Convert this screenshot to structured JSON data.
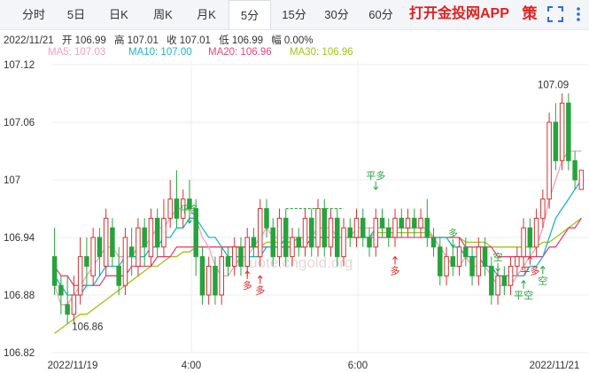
{
  "tabs": [
    {
      "label": "分时"
    },
    {
      "label": "5日"
    },
    {
      "label": "日K"
    },
    {
      "label": "周K"
    },
    {
      "label": "月K"
    },
    {
      "label": "5分"
    },
    {
      "label": "15分"
    },
    {
      "label": "30分"
    },
    {
      "label": "60分"
    }
  ],
  "active_tab": "5分",
  "promo": "打开金投网APP",
  "ce_badge": "策",
  "info": {
    "date": "2022/11/21",
    "open": "开 106.99",
    "high": "高 107.01",
    "close": "收 107.01",
    "low": "低 106.99",
    "change": "幅 0.00%"
  },
  "ma": [
    {
      "label": "MA5: 107.03",
      "color": "#f4a0b8"
    },
    {
      "label": "MA10: 107.00",
      "color": "#1fb3c8"
    },
    {
      "label": "MA20: 106.96",
      "color": "#e8457a"
    },
    {
      "label": "MA30: 106.96",
      "color": "#a2c21b"
    }
  ],
  "chart_data": {
    "type": "candlestick",
    "y_ticks": [
      "107.12",
      "107.06",
      "107",
      "106.94",
      "106.88",
      "106.82"
    ],
    "ylim": [
      106.82,
      107.12
    ],
    "x_ticks": [
      "2022/11/19",
      "4:00",
      "6:00",
      "2022/11/21"
    ],
    "annotations": {
      "high_label": "107.09",
      "low_label": "106.86",
      "signals": [
        "平多",
        "多",
        "多",
        "平多",
        "多",
        "多",
        "空",
        "平空",
        "平多",
        "空"
      ]
    },
    "watermark": "quote.cngold.org",
    "colors": {
      "up": "#d23232",
      "down": "#27a33d",
      "signal_up": "#e02020",
      "signal_down": "#27a33d"
    },
    "candles": [
      [
        106.92,
        106.89,
        106.95,
        106.88
      ],
      [
        106.89,
        106.88,
        106.9,
        106.86
      ],
      [
        106.87,
        106.86,
        106.9,
        106.85
      ],
      [
        106.86,
        106.88,
        106.9,
        106.85
      ],
      [
        106.88,
        106.92,
        106.94,
        106.87
      ],
      [
        106.92,
        106.91,
        106.94,
        106.89
      ],
      [
        106.9,
        106.94,
        106.95,
        106.89
      ],
      [
        106.94,
        106.92,
        106.95,
        106.9
      ],
      [
        106.91,
        106.96,
        106.97,
        106.9
      ],
      [
        106.95,
        106.92,
        106.96,
        106.91
      ],
      [
        106.91,
        106.89,
        106.93,
        106.88
      ],
      [
        106.89,
        106.94,
        106.95,
        106.88
      ],
      [
        106.93,
        106.92,
        106.95,
        106.9
      ],
      [
        106.91,
        106.95,
        106.96,
        106.9
      ],
      [
        106.95,
        106.93,
        106.96,
        106.91
      ],
      [
        106.92,
        106.96,
        106.97,
        106.91
      ],
      [
        106.96,
        106.93,
        106.97,
        106.92
      ],
      [
        106.93,
        106.96,
        106.98,
        106.92
      ],
      [
        106.96,
        106.98,
        107.0,
        106.95
      ],
      [
        106.98,
        106.96,
        107.01,
        106.95
      ],
      [
        106.96,
        106.98,
        106.99,
        106.95
      ],
      [
        106.98,
        106.97,
        107.0,
        106.96
      ],
      [
        106.97,
        106.92,
        106.98,
        106.9
      ],
      [
        106.92,
        106.88,
        106.93,
        106.87
      ],
      [
        106.88,
        106.91,
        106.92,
        106.87
      ],
      [
        106.91,
        106.88,
        106.92,
        106.87
      ],
      [
        106.88,
        106.92,
        106.93,
        106.87
      ],
      [
        106.92,
        106.91,
        106.93,
        106.9
      ],
      [
        106.91,
        106.93,
        106.94,
        106.9
      ],
      [
        106.93,
        106.91,
        106.94,
        106.9
      ],
      [
        106.91,
        106.94,
        106.95,
        106.9
      ],
      [
        106.94,
        106.93,
        106.95,
        106.92
      ],
      [
        106.92,
        106.97,
        106.98,
        106.91
      ],
      [
        106.97,
        106.95,
        106.98,
        106.94
      ],
      [
        106.95,
        106.92,
        106.96,
        106.91
      ],
      [
        106.92,
        106.96,
        106.97,
        106.91
      ],
      [
        106.96,
        106.92,
        106.97,
        106.91
      ],
      [
        106.92,
        106.94,
        106.95,
        106.91
      ],
      [
        106.94,
        106.93,
        106.95,
        106.92
      ],
      [
        106.93,
        106.96,
        106.97,
        106.92
      ],
      [
        106.96,
        106.93,
        106.97,
        106.92
      ],
      [
        106.93,
        106.97,
        106.98,
        106.92
      ],
      [
        106.97,
        106.93,
        106.98,
        106.92
      ],
      [
        106.93,
        106.96,
        106.97,
        106.92
      ],
      [
        106.96,
        106.92,
        106.97,
        106.91
      ],
      [
        106.92,
        106.95,
        106.96,
        106.91
      ],
      [
        106.95,
        106.94,
        106.96,
        106.93
      ],
      [
        106.94,
        106.96,
        106.97,
        106.93
      ],
      [
        106.96,
        106.94,
        106.97,
        106.93
      ],
      [
        106.94,
        106.93,
        106.95,
        106.92
      ],
      [
        106.93,
        106.96,
        106.97,
        106.92
      ],
      [
        106.96,
        106.95,
        106.97,
        106.94
      ],
      [
        106.95,
        106.94,
        106.96,
        106.93
      ],
      [
        106.94,
        106.96,
        106.97,
        106.93
      ],
      [
        106.96,
        106.95,
        106.97,
        106.94
      ],
      [
        106.95,
        106.96,
        106.97,
        106.94
      ],
      [
        106.96,
        106.95,
        106.97,
        106.94
      ],
      [
        106.95,
        106.96,
        106.97,
        106.94
      ],
      [
        106.96,
        106.94,
        106.98,
        106.93
      ],
      [
        106.94,
        106.93,
        106.95,
        106.92
      ],
      [
        106.93,
        106.9,
        106.94,
        106.89
      ],
      [
        106.9,
        106.92,
        106.93,
        106.89
      ],
      [
        106.92,
        106.91,
        106.93,
        106.9
      ],
      [
        106.91,
        106.93,
        106.94,
        106.9
      ],
      [
        106.93,
        106.92,
        106.94,
        106.91
      ],
      [
        106.92,
        106.9,
        106.93,
        106.89
      ],
      [
        106.9,
        106.93,
        106.94,
        106.89
      ],
      [
        106.93,
        106.91,
        106.94,
        106.9
      ],
      [
        106.91,
        106.88,
        106.92,
        106.87
      ],
      [
        106.88,
        106.9,
        106.91,
        106.87
      ],
      [
        106.9,
        106.89,
        106.91,
        106.88
      ],
      [
        106.89,
        106.91,
        106.92,
        106.88
      ],
      [
        106.91,
        106.92,
        106.93,
        106.9
      ],
      [
        106.92,
        106.95,
        106.96,
        106.91
      ],
      [
        106.95,
        106.93,
        106.96,
        106.92
      ],
      [
        106.93,
        106.96,
        106.97,
        106.92
      ],
      [
        106.96,
        106.98,
        106.99,
        106.95
      ],
      [
        106.98,
        107.06,
        107.07,
        106.97
      ],
      [
        107.06,
        107.02,
        107.08,
        107.01
      ],
      [
        107.02,
        107.08,
        107.09,
        107.01
      ],
      [
        107.08,
        107.02,
        107.09,
        107.01
      ],
      [
        107.02,
        107.0,
        107.03,
        106.99
      ],
      [
        106.99,
        107.01,
        107.01,
        106.99
      ]
    ],
    "ma_series": {
      "ma5": [
        106.89,
        106.87,
        106.87,
        106.88,
        106.89,
        106.9,
        106.91,
        106.92,
        106.93,
        106.93,
        106.92,
        106.92,
        106.92,
        106.93,
        106.93,
        106.94,
        106.95,
        106.95,
        106.96,
        106.97,
        106.97,
        106.97,
        106.96,
        106.94,
        106.93,
        106.91,
        106.9,
        106.9,
        106.91,
        106.92,
        106.92,
        106.93,
        106.94,
        106.95,
        106.94,
        106.94,
        106.94,
        106.94,
        106.94,
        106.94,
        106.94,
        106.95,
        106.95,
        106.95,
        106.94,
        106.94,
        106.94,
        106.95,
        106.95,
        106.95,
        106.95,
        106.95,
        106.95,
        106.95,
        106.95,
        106.95,
        106.95,
        106.95,
        106.95,
        106.94,
        106.93,
        106.92,
        106.91,
        106.91,
        106.92,
        106.91,
        106.91,
        106.91,
        106.9,
        106.89,
        106.89,
        106.89,
        106.9,
        106.91,
        106.92,
        106.93,
        106.95,
        106.98,
        107.0,
        107.02,
        107.03,
        107.03,
        107.03
      ],
      "ma10": [
        106.9,
        106.89,
        106.88,
        106.88,
        106.88,
        106.89,
        106.89,
        106.9,
        106.91,
        106.91,
        106.91,
        106.92,
        106.92,
        106.92,
        106.92,
        106.93,
        106.93,
        106.94,
        106.94,
        106.95,
        106.95,
        106.96,
        106.96,
        106.95,
        106.94,
        106.94,
        106.93,
        106.92,
        106.92,
        106.92,
        106.92,
        106.92,
        106.92,
        106.93,
        106.93,
        106.93,
        106.94,
        106.94,
        106.94,
        106.94,
        106.94,
        106.94,
        106.94,
        106.94,
        106.94,
        106.94,
        106.94,
        106.94,
        106.94,
        106.94,
        106.95,
        106.95,
        106.95,
        106.95,
        106.95,
        106.95,
        106.95,
        106.95,
        106.95,
        106.94,
        106.94,
        106.94,
        106.93,
        106.93,
        106.92,
        106.92,
        106.92,
        106.91,
        106.91,
        106.9,
        106.9,
        106.9,
        106.9,
        106.9,
        106.91,
        106.91,
        106.92,
        106.94,
        106.96,
        106.97,
        106.98,
        106.99,
        107.0
      ],
      "ma20": [
        106.91,
        106.9,
        106.9,
        106.89,
        106.89,
        106.89,
        106.89,
        106.89,
        106.9,
        106.9,
        106.9,
        106.9,
        106.91,
        106.91,
        106.91,
        106.91,
        106.92,
        106.92,
        106.92,
        106.93,
        106.93,
        106.93,
        106.93,
        106.93,
        106.93,
        106.93,
        106.93,
        106.93,
        106.93,
        106.93,
        106.93,
        106.93,
        106.93,
        106.93,
        106.93,
        106.93,
        106.93,
        106.93,
        106.93,
        106.93,
        106.94,
        106.94,
        106.94,
        106.94,
        106.94,
        106.94,
        106.94,
        106.94,
        106.94,
        106.94,
        106.94,
        106.94,
        106.94,
        106.94,
        106.94,
        106.94,
        106.94,
        106.94,
        106.94,
        106.94,
        106.94,
        106.94,
        106.94,
        106.94,
        106.93,
        106.93,
        106.93,
        106.93,
        106.93,
        106.92,
        106.92,
        106.92,
        106.92,
        106.92,
        106.92,
        106.92,
        106.92,
        106.93,
        106.93,
        106.94,
        106.95,
        106.95,
        106.96
      ],
      "ma30": [
        106.84,
        106.845,
        106.85,
        106.855,
        106.86,
        106.86,
        106.865,
        106.87,
        106.875,
        106.88,
        106.885,
        106.89,
        106.895,
        106.9,
        106.905,
        106.91,
        106.91,
        106.915,
        106.92,
        106.92,
        106.925,
        106.925,
        106.93,
        106.93,
        106.93,
        106.93,
        106.93,
        106.93,
        106.93,
        106.93,
        106.93,
        106.93,
        106.93,
        106.935,
        106.935,
        106.935,
        106.935,
        106.935,
        106.94,
        106.94,
        106.94,
        106.94,
        106.94,
        106.94,
        106.94,
        106.94,
        106.94,
        106.94,
        106.94,
        106.94,
        106.945,
        106.945,
        106.945,
        106.945,
        106.945,
        106.945,
        106.945,
        106.945,
        106.945,
        106.94,
        106.94,
        106.94,
        106.94,
        106.94,
        106.935,
        106.935,
        106.935,
        106.935,
        106.93,
        106.93,
        106.93,
        106.93,
        106.93,
        106.93,
        106.93,
        106.93,
        106.935,
        106.935,
        106.94,
        106.945,
        106.95,
        106.955,
        106.96
      ]
    }
  }
}
